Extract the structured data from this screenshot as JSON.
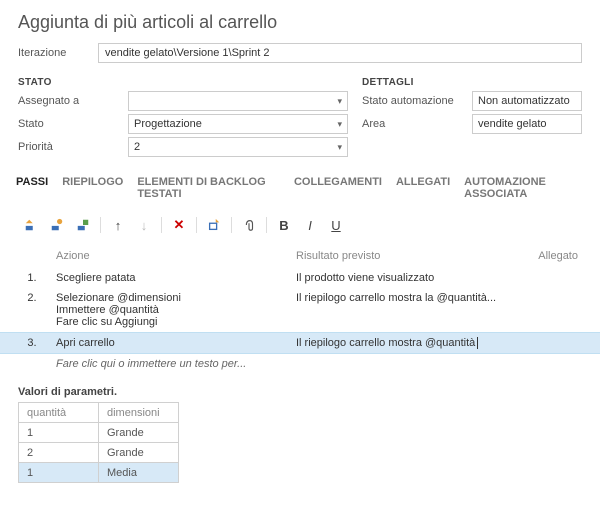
{
  "title": "Aggiunta di più articoli al carrello",
  "iteration": {
    "label": "Iterazione",
    "value": "vendite gelato\\Versione 1\\Sprint 2"
  },
  "stato": {
    "header": "STATO",
    "fields": {
      "assegnato": {
        "label": "Assegnato a",
        "value": ""
      },
      "stato": {
        "label": "Stato",
        "value": "Progettazione"
      },
      "priorita": {
        "label": "Priorità",
        "value": "2"
      }
    }
  },
  "dettagli": {
    "header": "DETTAGLI",
    "fields": {
      "autom": {
        "label": "Stato automazione",
        "value": "Non automatizzato"
      },
      "area": {
        "label": "Area",
        "value": "vendite gelato"
      }
    }
  },
  "tabs": [
    "PASSI",
    "RIEPILOGO",
    "ELEMENTI DI BACKLOG TESTATI",
    "COLLEGAMENTI",
    "ALLEGATI",
    "AUTOMAZIONE ASSOCIATA"
  ],
  "grid": {
    "headers": {
      "num": "",
      "action": "Azione",
      "result": "Risultato previsto",
      "attach": "Allegato"
    },
    "rows": [
      {
        "n": "1.",
        "actions": [
          "Scegliere patata"
        ],
        "result": "Il prodotto viene visualizzato"
      },
      {
        "n": "2.",
        "actions": [
          "Selezionare @dimensioni",
          "Immettere @quantità",
          "Fare clic su Aggiungi"
        ],
        "result": "Il riepilogo carrello mostra la @quantità..."
      },
      {
        "n": "3.",
        "actions": [
          "Apri carrello"
        ],
        "result": "Il riepilogo carrello mostra @quantità",
        "selected": true
      }
    ],
    "placeholder": "Fare clic qui o immettere un testo per..."
  },
  "params": {
    "title": "Valori di parametri.",
    "cols": [
      "quantità",
      "dimensioni"
    ],
    "rows": [
      {
        "q": "1",
        "d": "Grande"
      },
      {
        "q": "2",
        "d": "Grande"
      },
      {
        "q": "1",
        "d": "Media",
        "selected": true
      }
    ]
  },
  "toolbar": {
    "bold": "B",
    "italic": "I",
    "underline": "U"
  }
}
